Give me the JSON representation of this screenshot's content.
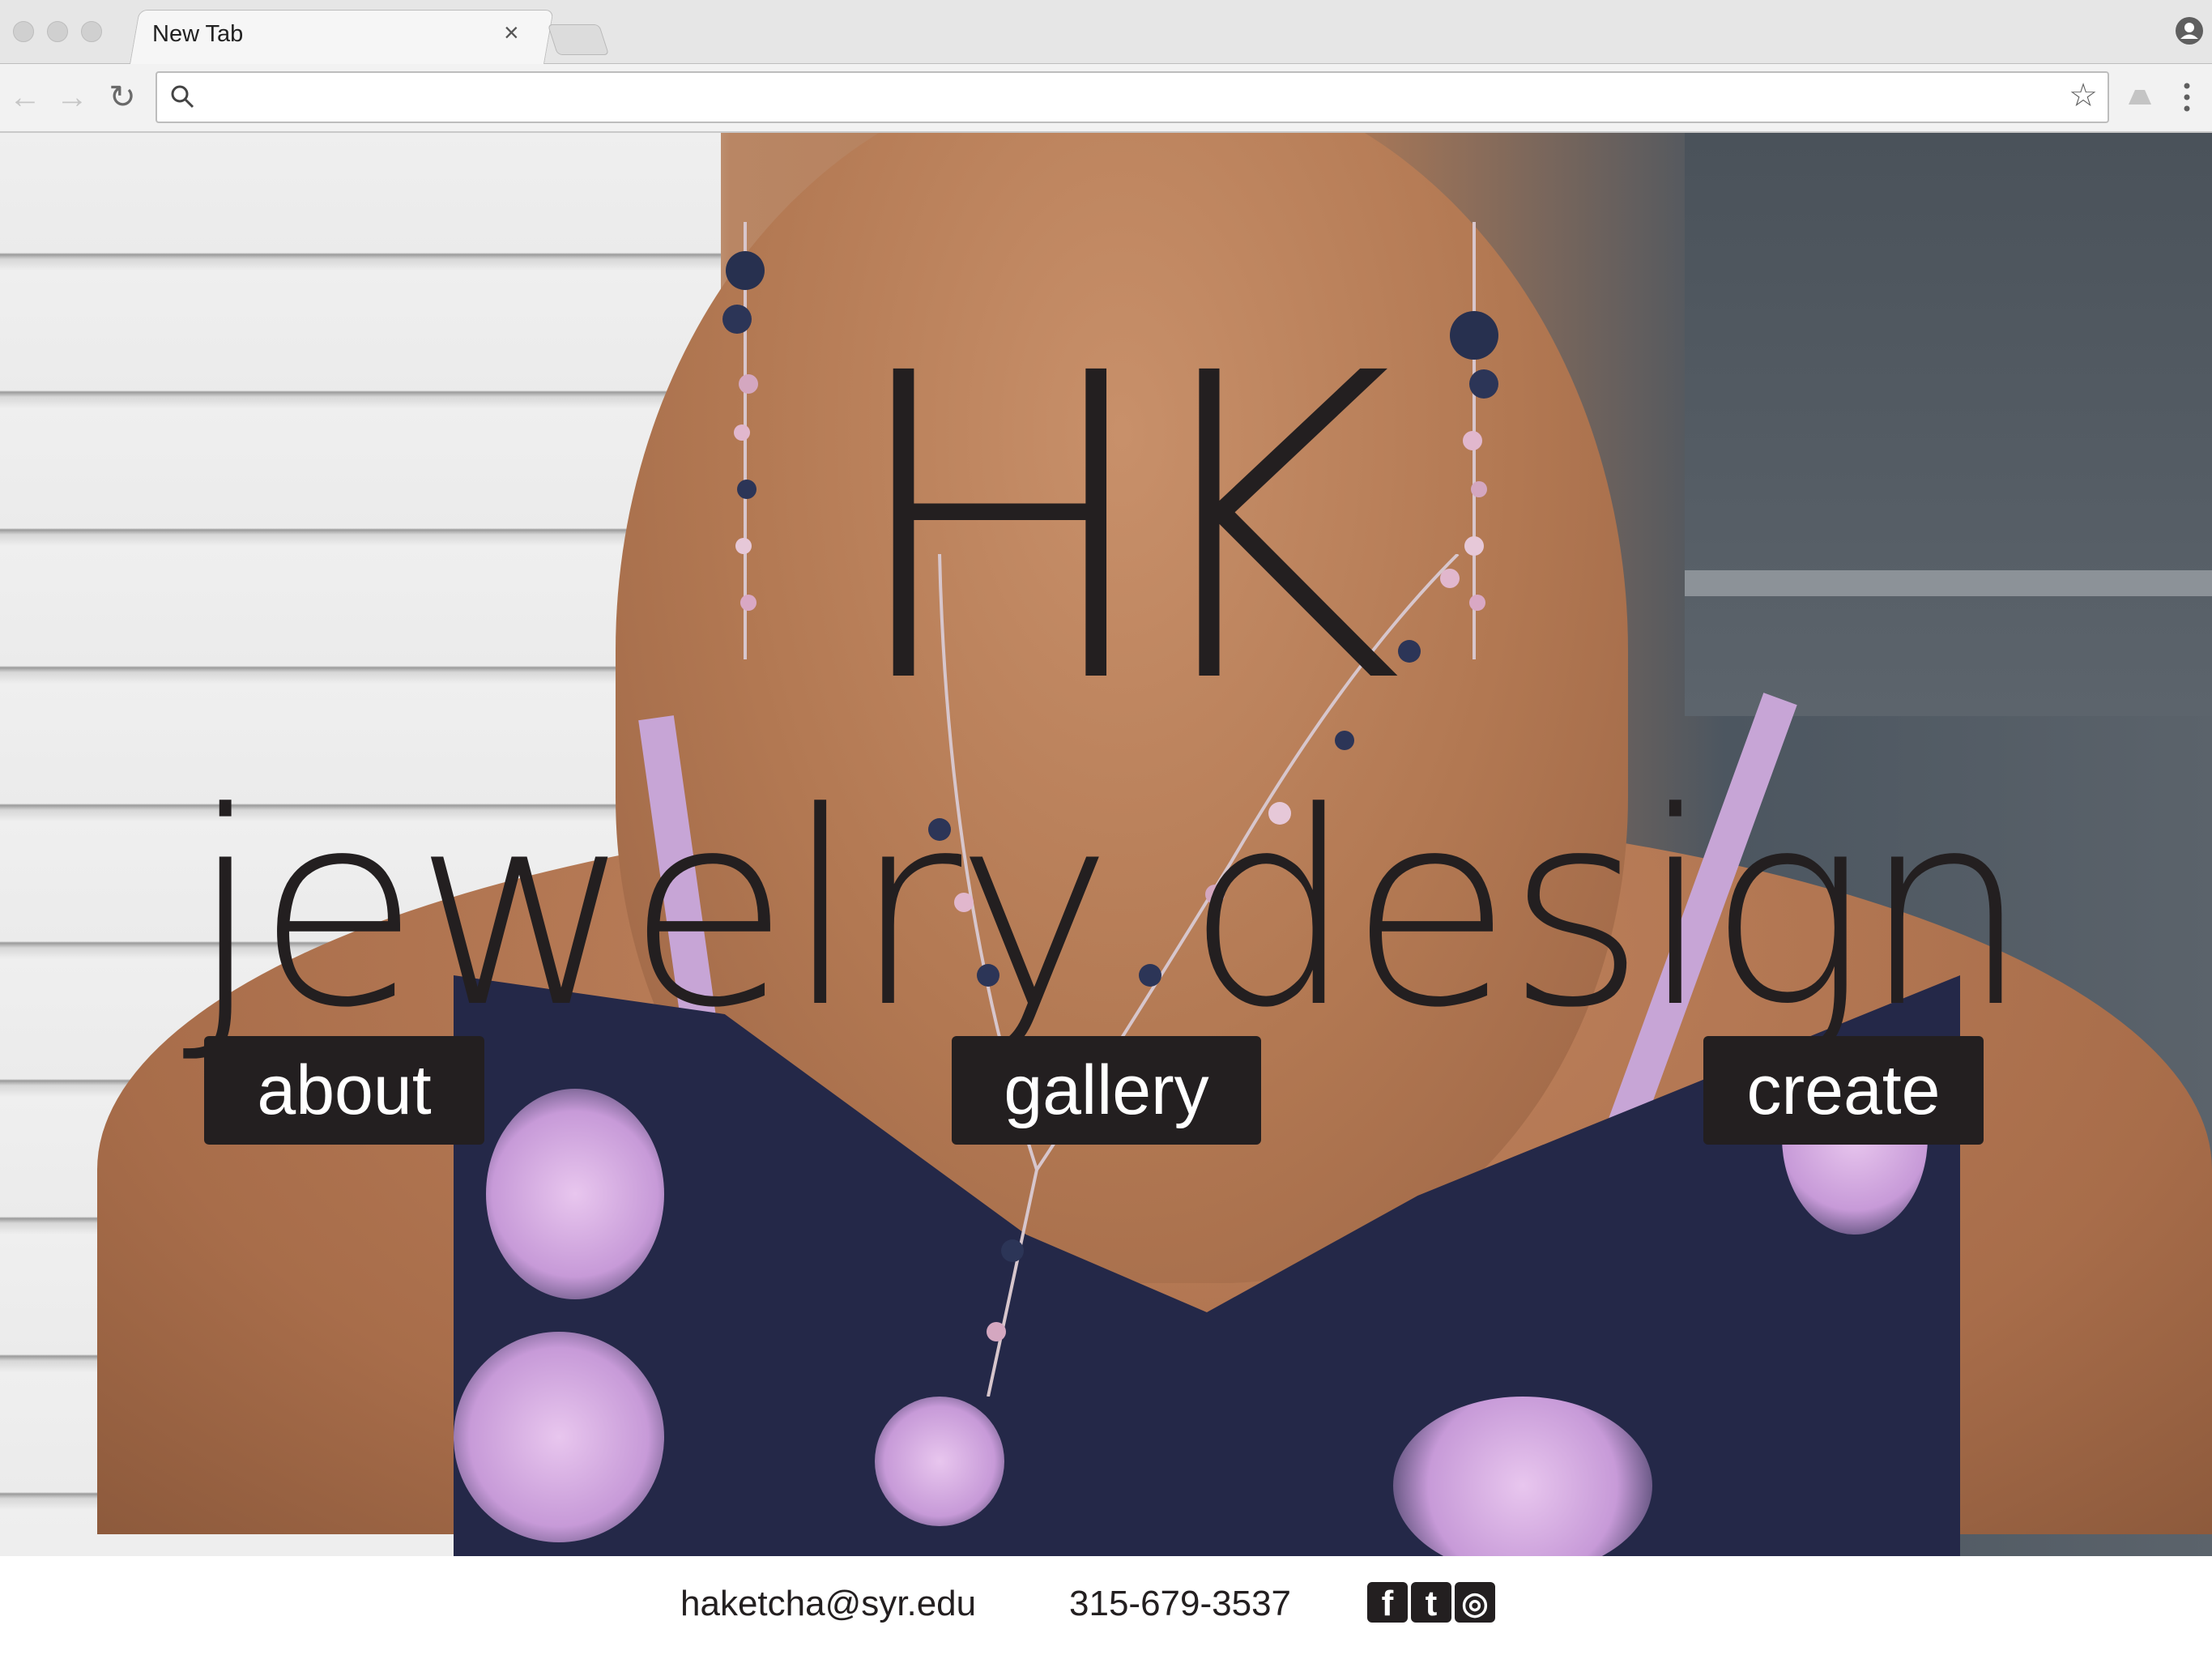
{
  "browser": {
    "tab_title": "New Tab",
    "tab_close": "×",
    "address_value": "",
    "star": "☆"
  },
  "hero": {
    "logo": "HK",
    "tagline": "jewelry design"
  },
  "nav": {
    "about": "about",
    "gallery": "gallery",
    "create": "create"
  },
  "footer": {
    "email": "haketcha@syr.edu",
    "phone": "315-679-3537",
    "social": [
      {
        "icon": "facebook-icon",
        "glyph": "f"
      },
      {
        "icon": "twitter-icon",
        "glyph": "t"
      },
      {
        "icon": "instagram-icon",
        "glyph": "◎"
      }
    ]
  },
  "colors": {
    "text_dark": "#231f20",
    "button_bg": "#231f20",
    "button_text": "#ffffff"
  }
}
